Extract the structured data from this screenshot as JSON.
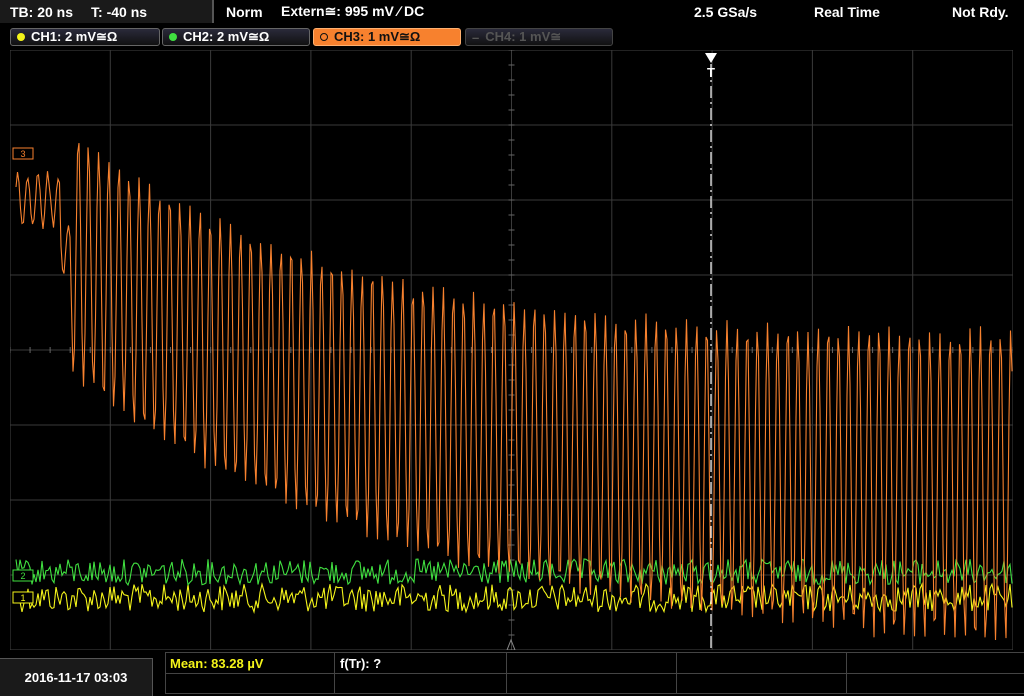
{
  "topbar": {
    "timebase": "TB: 20 ns",
    "trigger_time": "T: -40 ns",
    "mode": "Norm",
    "trigger_source": "Extern≅: 995 mV ∕ DC",
    "sample_rate": "2.5 GSa/s",
    "acq_mode": "Real Time",
    "run_state": "Not Rdy."
  },
  "channels": [
    {
      "label": "CH1: 2 mV≅Ω",
      "color": "#f4f41a",
      "state": "on"
    },
    {
      "label": "CH2: 2 mV≅Ω",
      "color": "#40e040",
      "state": "on"
    },
    {
      "label": "CH3: 1 mV≅Ω",
      "color": "#f7812e",
      "state": "active"
    },
    {
      "label": "CH4: 1 mV≅",
      "color": "#555555",
      "state": "off"
    }
  ],
  "markers": {
    "ch3": "3",
    "ch2": "2",
    "ch1": "1",
    "trigger": "T"
  },
  "bottombar": {
    "datetime": "2016-11-17 03:03",
    "mean": "Mean: 83.28 µV",
    "ftr": "f(Tr): ?"
  },
  "colors": {
    "ch1": "#f4f41a",
    "ch2": "#40e040",
    "ch3": "#f7812e",
    "grid": "#3a3a3a",
    "trigger_line": "#ffffff"
  }
}
